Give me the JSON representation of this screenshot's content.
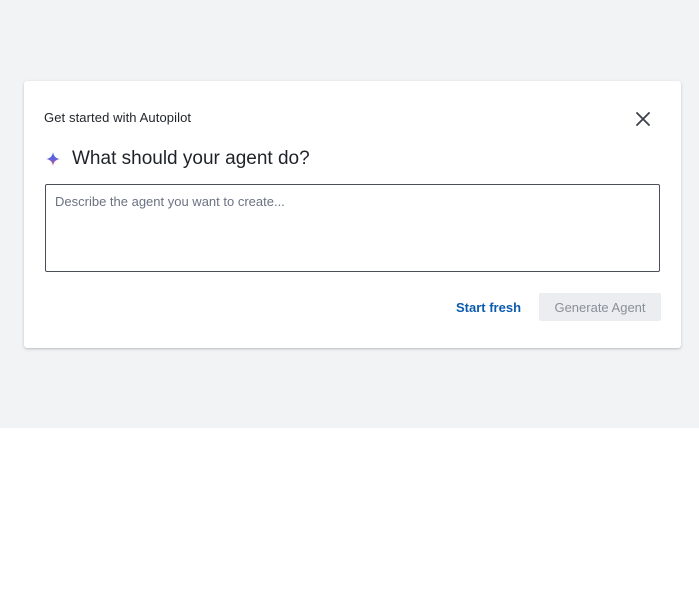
{
  "dialog": {
    "title": "Get started with Autopilot",
    "heading": "What should your agent do?",
    "prompt_placeholder": "Describe the agent you want to create...",
    "prompt_value": "",
    "start_fresh_label": "Start fresh",
    "generate_label": "Generate Agent"
  },
  "icons": {
    "close": "close-icon",
    "sparkle": "sparkle-icon"
  },
  "colors": {
    "link": "#0b5cad",
    "sparkle_top": "#2f6fe4",
    "sparkle_bottom": "#e2556b",
    "disabled_bg": "#ebedf0",
    "disabled_text": "#8a9099",
    "backdrop": "#f2f3f5"
  }
}
